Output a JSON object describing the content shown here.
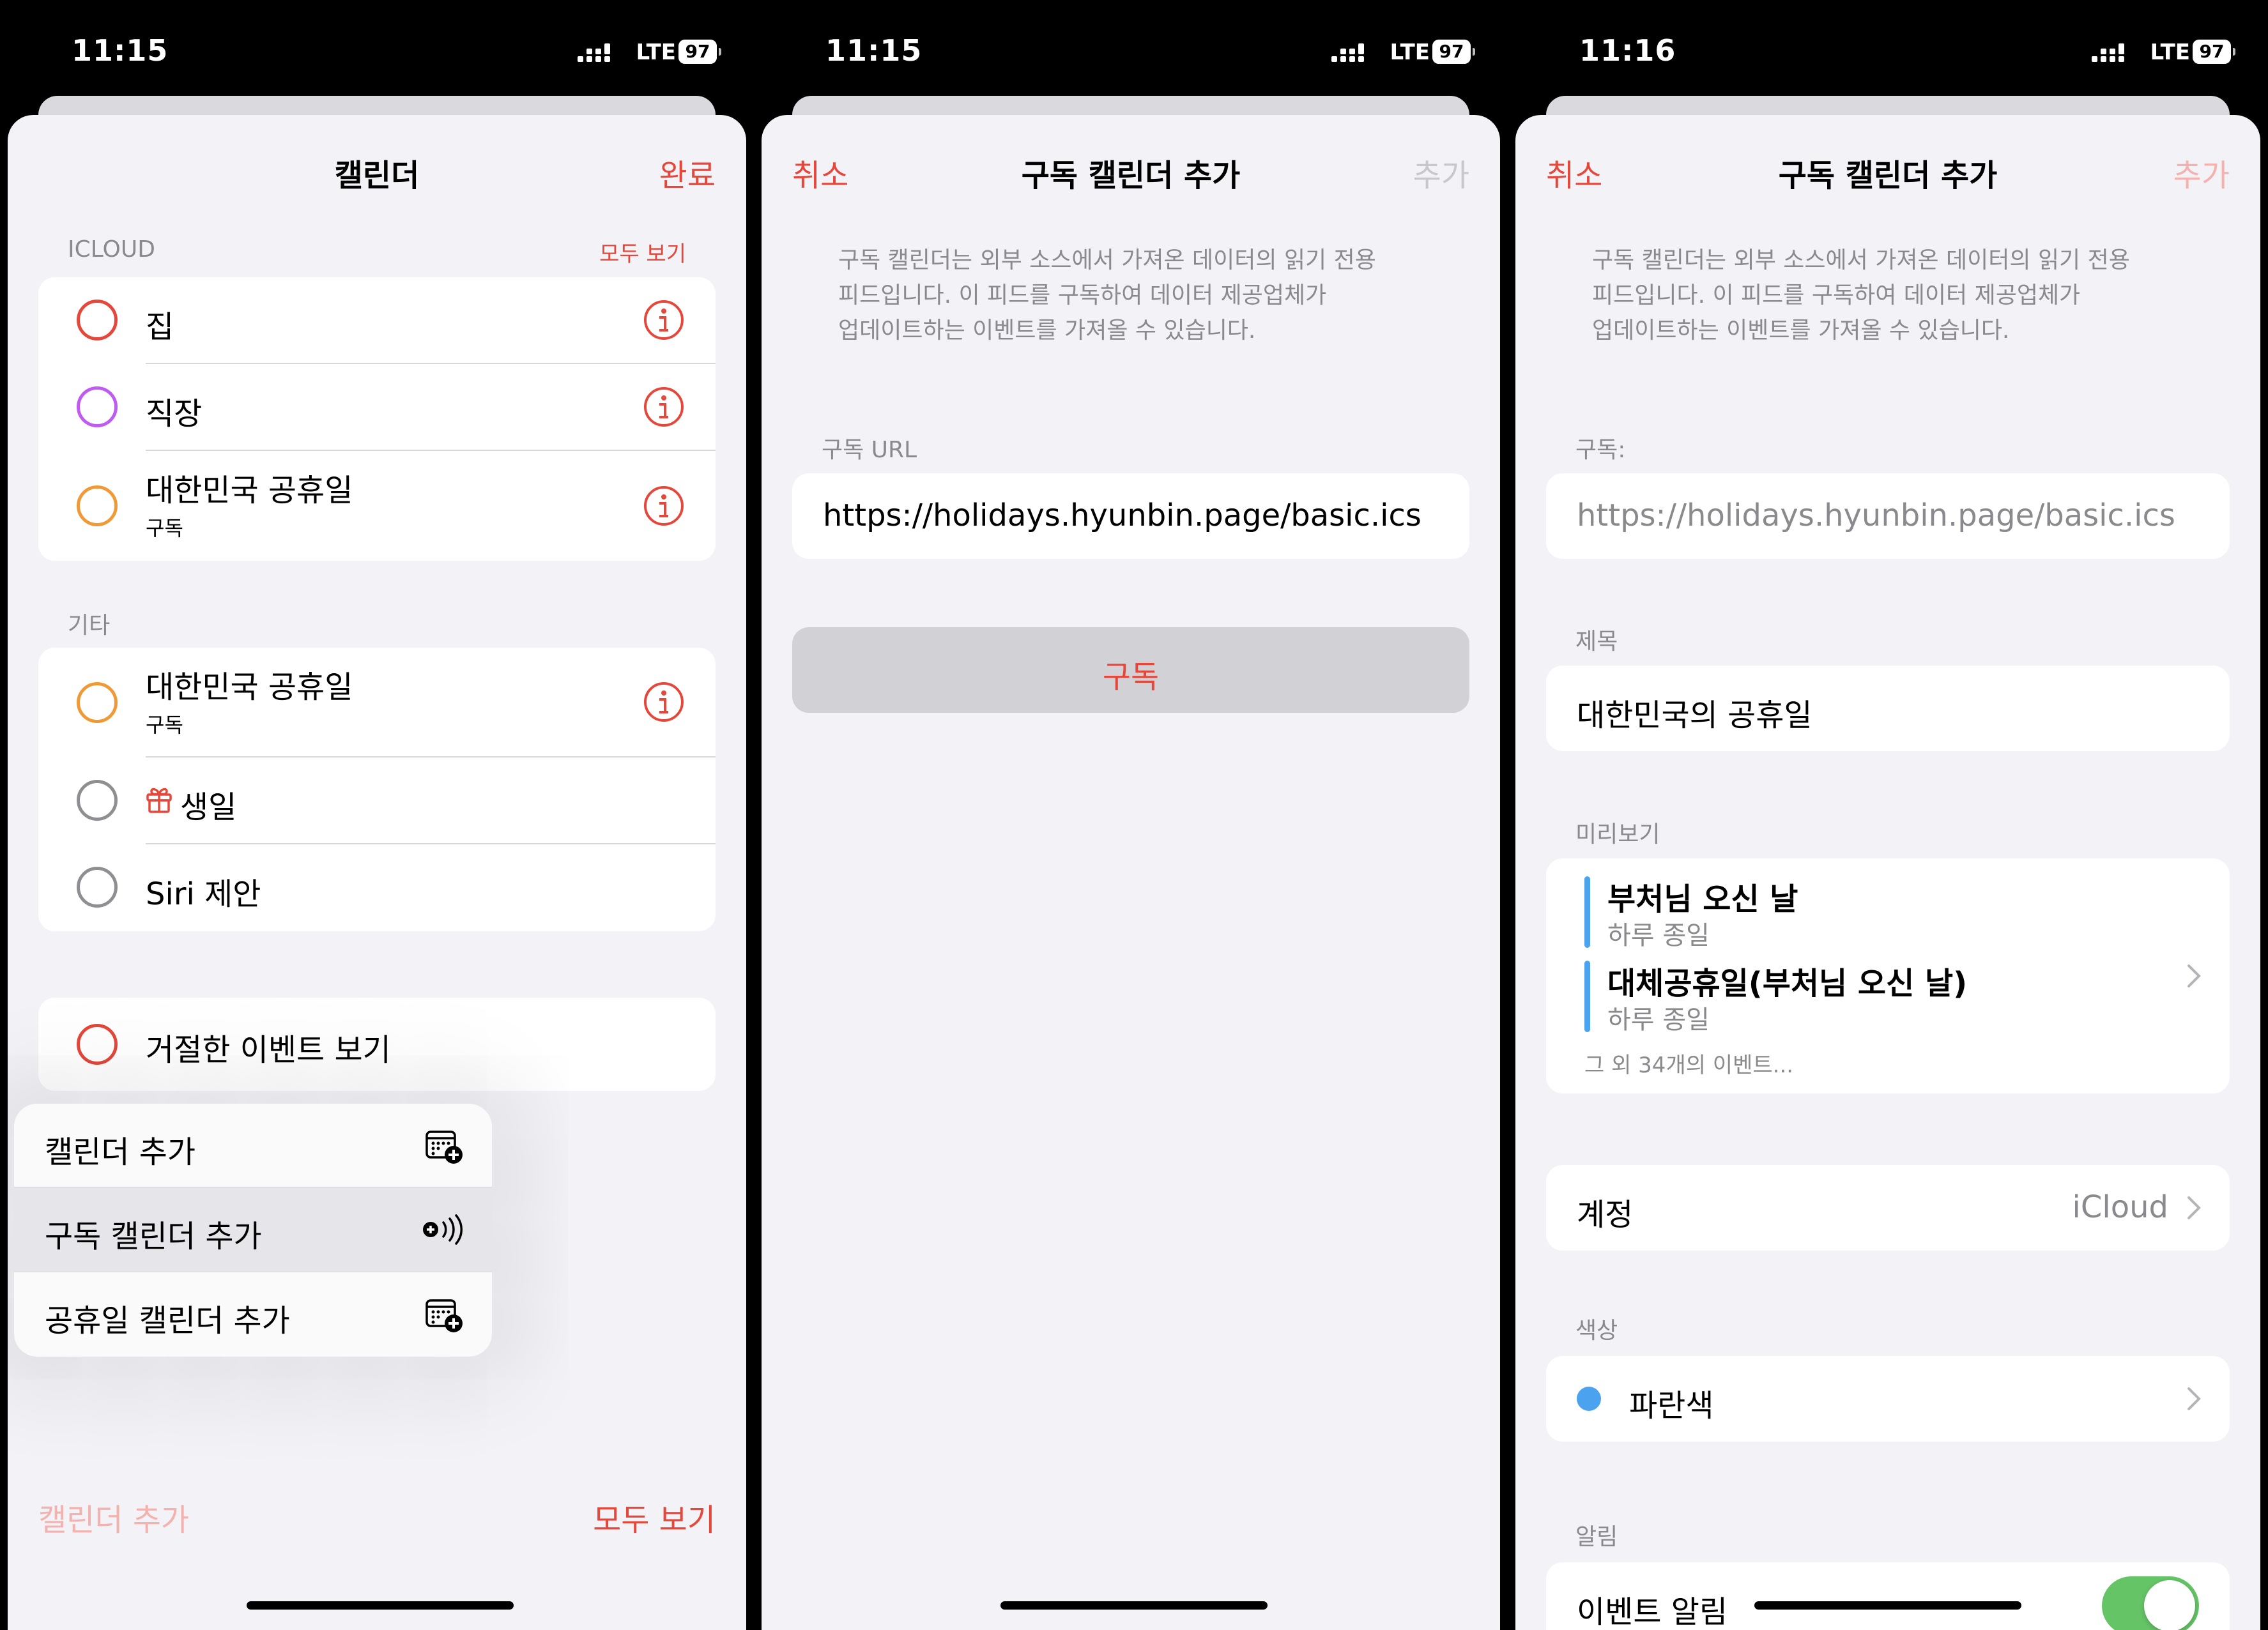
{
  "screens": [
    {
      "status": {
        "time": "11:15",
        "network": "LTE",
        "battery": "97"
      },
      "nav": {
        "title": "캘린더",
        "done": "완료"
      },
      "icloud": {
        "header": "ICLOUD",
        "show_all": "모두 보기",
        "items": [
          {
            "label": "집",
            "color": "#e5473a"
          },
          {
            "label": "직장",
            "color": "#bf5af2"
          },
          {
            "label": "대한민국 공휴일",
            "sub": "구독",
            "color": "#f09a37"
          }
        ]
      },
      "other": {
        "header": "기타",
        "items": [
          {
            "label": "대한민국 공휴일",
            "sub": "구독",
            "color": "#f09a37"
          },
          {
            "label": "생일",
            "icon": "gift-icon",
            "color": "#8e8e93"
          },
          {
            "label": "Siri 제안",
            "color": "#8e8e93"
          }
        ]
      },
      "declined": {
        "label": "거절한 이벤트 보기",
        "color": "#e5473a"
      },
      "menu": [
        {
          "label": "캘린더 추가",
          "icon": "calendar-add-icon"
        },
        {
          "label": "구독 캘린더 추가",
          "icon": "subscribe-broadcast-icon"
        },
        {
          "label": "공휴일 캘린더 추가",
          "icon": "calendar-add-icon"
        }
      ],
      "toolbar": {
        "add_calendar": "캘린더 추가",
        "show_all": "모두 보기"
      }
    },
    {
      "status": {
        "time": "11:15",
        "network": "LTE",
        "battery": "97"
      },
      "nav": {
        "cancel": "취소",
        "title": "구독 캘린더 추가",
        "add": "추가"
      },
      "description": [
        "구독 캘린더는 외부 소스에서 가져온 데이터의 읽기 전용",
        "피드입니다. 이 피드를 구독하여 데이터 제공업체가",
        "업데이트하는 이벤트를 가져올 수 있습니다."
      ],
      "url": {
        "header": "구독 URL",
        "value": "https://holidays.hyunbin.page/basic.ics"
      },
      "subscribe_label": "구독"
    },
    {
      "status": {
        "time": "11:16",
        "network": "LTE",
        "battery": "97"
      },
      "nav": {
        "cancel": "취소",
        "title": "구독 캘린더 추가",
        "add": "추가"
      },
      "description": [
        "구독 캘린더는 외부 소스에서 가져온 데이터의 읽기 전용",
        "피드입니다. 이 피드를 구독하여 데이터 제공업체가",
        "업데이트하는 이벤트를 가져올 수 있습니다."
      ],
      "subscription": {
        "header": "구독:",
        "value": "https://holidays.hyunbin.page/basic.ics"
      },
      "title_field": {
        "header": "제목",
        "value": "대한민국의 공휴일"
      },
      "preview": {
        "header": "미리보기",
        "events": [
          {
            "title": "부처님 오신 날",
            "sub": "하루 종일"
          },
          {
            "title": "대체공휴일(부처님 오신 날)",
            "sub": "하루 종일"
          }
        ],
        "more": "그 외 34개의 이벤트..."
      },
      "account": {
        "label": "계정",
        "value": "iCloud"
      },
      "color": {
        "header": "색상",
        "label": "파란색",
        "swatch": "#4ba3ef"
      },
      "alerts": {
        "header": "알림",
        "label": "이벤트 알림",
        "toggle_on": true,
        "toggle_color": "#65c466"
      }
    }
  ],
  "colors": {
    "accent": "#e5473a",
    "background": "#f2f2f7",
    "card": "#ffffff",
    "secondary_text": "#8a8a8e"
  }
}
